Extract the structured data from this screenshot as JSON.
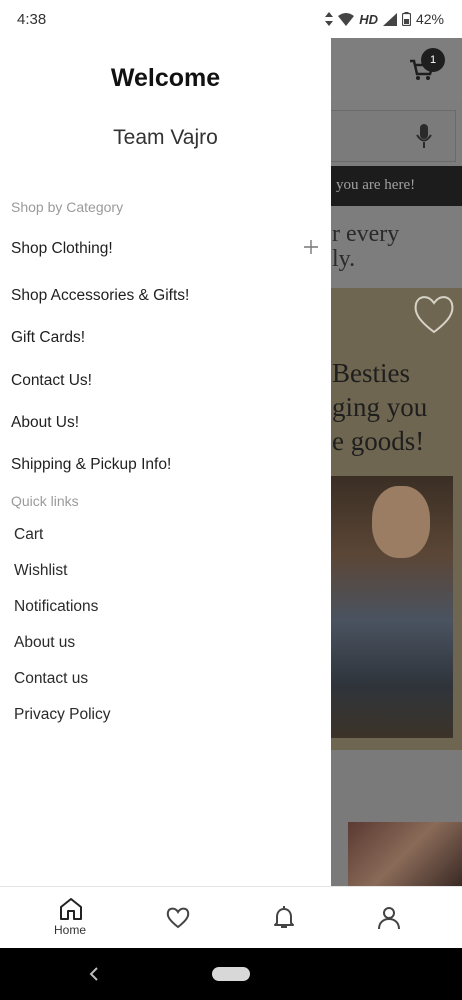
{
  "status_bar": {
    "time": "4:38",
    "network": "HD",
    "battery": "42%"
  },
  "background": {
    "cart_badge": "1",
    "banner_text": "you are here!",
    "tagline": [
      "r every",
      "ly."
    ],
    "panel_text": [
      "Besties",
      "ging you",
      "e goods!"
    ]
  },
  "drawer": {
    "welcome": "Welcome",
    "store_name": "Team Vajro",
    "categories_label": "Shop by Category",
    "categories": [
      {
        "label": "Shop Clothing!"
      },
      {
        "label": "Shop Accessories & Gifts!"
      },
      {
        "label": "Gift Cards!"
      },
      {
        "label": "Contact Us!"
      },
      {
        "label": "About Us!"
      },
      {
        "label": "Shipping & Pickup Info!"
      }
    ],
    "quick_links_label": "Quick links",
    "quick_links": [
      {
        "label": "Cart"
      },
      {
        "label": "Wishlist"
      },
      {
        "label": "Notifications"
      },
      {
        "label": "About us"
      },
      {
        "label": "Contact us"
      },
      {
        "label": "Privacy Policy"
      }
    ]
  },
  "bottom_nav": {
    "home_label": "Home",
    "icons": [
      "home-icon",
      "heart-icon",
      "bell-icon",
      "user-icon"
    ]
  },
  "colors": {
    "drawer_bg": "#ffffff",
    "scrim": "#7d7d7d",
    "text_primary": "#1f1f1f",
    "text_muted": "#9a9a9a"
  }
}
